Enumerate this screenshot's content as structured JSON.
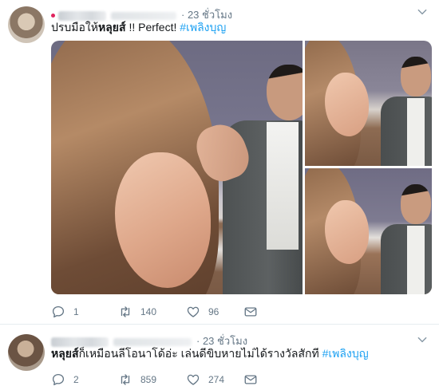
{
  "tweets": [
    {
      "time": "· 23 ชั่วโมง",
      "text_plain": "ปรบมือให้",
      "text_bold": "หลุยส์",
      "text_rest": " !! Perfect! ",
      "hashtag": "#เพลิงบุญ",
      "replies": "1",
      "retweets": "140",
      "likes": "96",
      "media_alt": [
        "main-image",
        "top-right-image",
        "bottom-right-image"
      ]
    },
    {
      "time": "· 23 ชั่วโมง",
      "text_bold": "หลุยส์",
      "text_rest": "ก็เหมือนลีโอนาโด้อ่ะ เล่นดีขิบหายไม่ได้รางวัลสักที ",
      "hashtag": "#เพลิงบุญ",
      "replies": "2",
      "retweets": "859",
      "likes": "274"
    }
  ],
  "colors": {
    "hashtag": "#1da1f2",
    "muted": "#657786",
    "text": "#14171a",
    "divider": "#e6ecf0"
  },
  "icons": [
    "chevron-down-icon",
    "reply-icon",
    "retweet-icon",
    "like-icon",
    "direct-message-icon"
  ]
}
